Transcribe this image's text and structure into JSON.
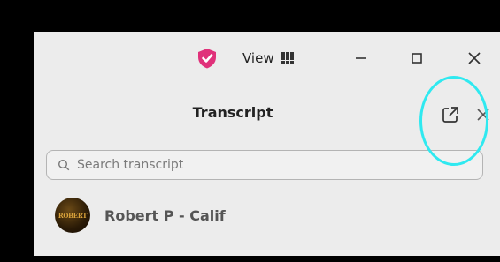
{
  "titlebar": {
    "view_label": "View",
    "icons": [
      "shield-icon",
      "grid-icon",
      "minimize-icon",
      "maximize-icon",
      "close-icon"
    ],
    "shield_color": "#e0317a"
  },
  "transcript": {
    "title": "Transcript",
    "popout_icon": "popout-icon",
    "close_icon": "close-icon",
    "highlight_color": "#2fe9f0"
  },
  "search": {
    "placeholder": "Search transcript",
    "value": ""
  },
  "speaker": {
    "name": "Robert P - Calif",
    "avatar_text": "ROBERT"
  }
}
